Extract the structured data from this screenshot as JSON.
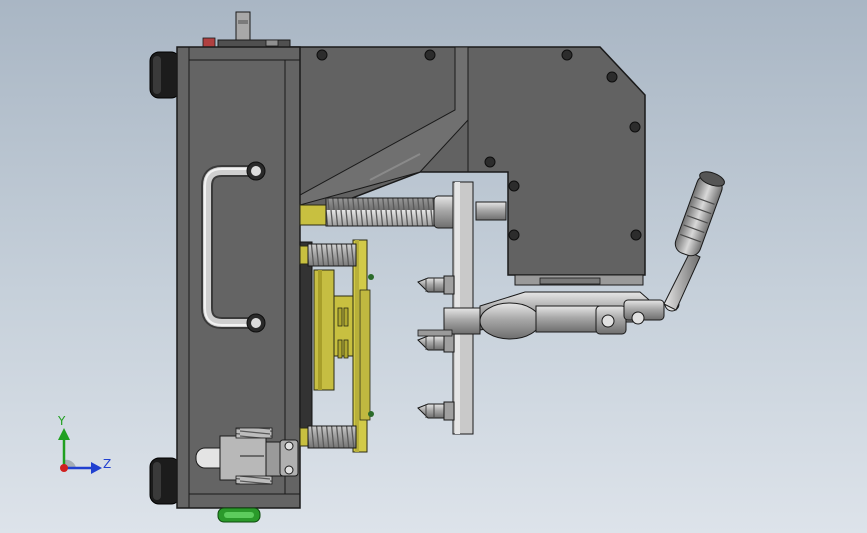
{
  "view": {
    "background_top": "#a9b6c4",
    "background_bottom": "#dde3ea",
    "body_color": "#636363",
    "edge_color": "#1a1a1a",
    "fixture_yellow": "#c8c040",
    "steel_color": "#b4b4b4"
  },
  "triad": {
    "y_label": "Y",
    "z_label": "Z",
    "y_color": "#20a020",
    "z_color": "#2040d0",
    "origin_color": "#d02020"
  }
}
